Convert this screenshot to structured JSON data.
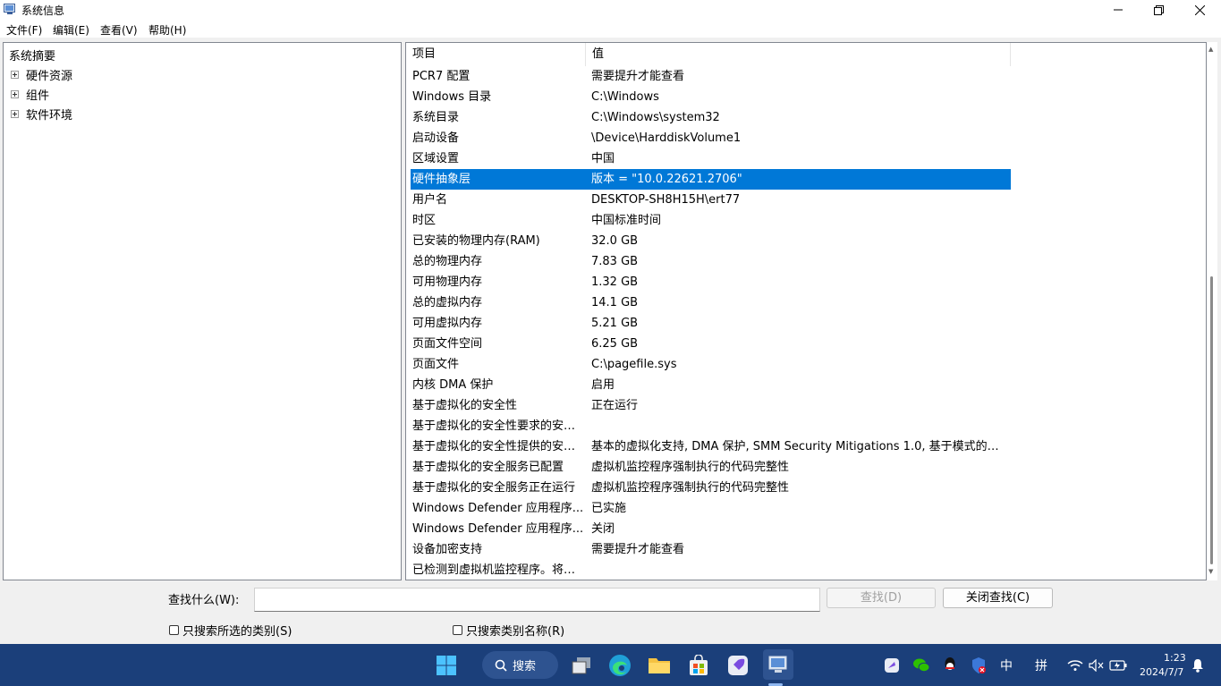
{
  "window": {
    "title": "系统信息"
  },
  "menu": [
    "文件(F)",
    "编辑(E)",
    "查看(V)",
    "帮助(H)"
  ],
  "tree": {
    "root": "系统摘要",
    "children": [
      "硬件资源",
      "组件",
      "软件环境"
    ]
  },
  "list": {
    "headers": {
      "item": "项目",
      "value": "值"
    },
    "selected_index": 5,
    "rows": [
      {
        "item": "PCR7 配置",
        "value": "需要提升才能查看"
      },
      {
        "item": "Windows 目录",
        "value": "C:\\Windows"
      },
      {
        "item": "系统目录",
        "value": "C:\\Windows\\system32"
      },
      {
        "item": "启动设备",
        "value": "\\Device\\HarddiskVolume1"
      },
      {
        "item": "区域设置",
        "value": "中国"
      },
      {
        "item": "硬件抽象层",
        "value": "版本 = \"10.0.22621.2706\""
      },
      {
        "item": "用户名",
        "value": "DESKTOP-SH8H15H\\ert77"
      },
      {
        "item": "时区",
        "value": "中国标准时间"
      },
      {
        "item": "已安装的物理内存(RAM)",
        "value": "32.0 GB"
      },
      {
        "item": "总的物理内存",
        "value": "7.83 GB"
      },
      {
        "item": "可用物理内存",
        "value": "1.32 GB"
      },
      {
        "item": "总的虚拟内存",
        "value": "14.1 GB"
      },
      {
        "item": "可用虚拟内存",
        "value": "5.21 GB"
      },
      {
        "item": "页面文件空间",
        "value": "6.25 GB"
      },
      {
        "item": "页面文件",
        "value": "C:\\pagefile.sys"
      },
      {
        "item": "内核 DMA 保护",
        "value": "启用"
      },
      {
        "item": "基于虚拟化的安全性",
        "value": "正在运行"
      },
      {
        "item": "基于虚拟化的安全性要求的安全...",
        "value": ""
      },
      {
        "item": "基于虚拟化的安全性提供的安全...",
        "value": "基本的虚拟化支持, DMA 保护, SMM Security Mitigations 1.0, 基于模式的执..."
      },
      {
        "item": "基于虚拟化的安全服务已配置",
        "value": "虚拟机监控程序强制执行的代码完整性"
      },
      {
        "item": "基于虚拟化的安全服务正在运行",
        "value": "虚拟机监控程序强制执行的代码完整性"
      },
      {
        "item": "Windows Defender 应用程序...",
        "value": "已实施"
      },
      {
        "item": "Windows Defender 应用程序...",
        "value": "关闭"
      },
      {
        "item": "设备加密支持",
        "value": "需要提升才能查看"
      },
      {
        "item": "已检测到虚拟机监控程序。将不...",
        "value": ""
      }
    ]
  },
  "find": {
    "label": "查找什么(W):",
    "input_value": "",
    "find_button": "查找(D)",
    "close_button": "关闭查找(C)",
    "checkbox_selected_category": "只搜索所选的类别(S)",
    "checkbox_category_names": "只搜索类别名称(R)"
  },
  "taskbar": {
    "search_label": "搜索",
    "ime_lang": "中",
    "ime_mode": "拼",
    "time": "1:23",
    "date": "2024/7/7"
  },
  "colors": {
    "selection": "#0078d7",
    "taskbar": "#1b3f7a"
  }
}
